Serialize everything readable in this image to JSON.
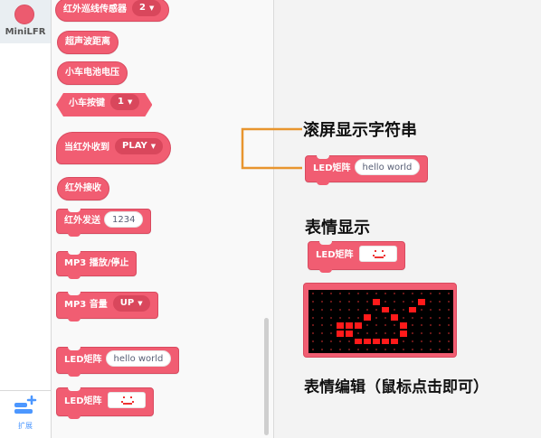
{
  "category_bar": {
    "device_label": "MiniLFR",
    "extension_label": "扩展"
  },
  "palette": {
    "blocks": [
      {
        "label": "红外巡线传感器",
        "dropdown": "2"
      },
      {
        "label": "超声波距离"
      },
      {
        "label": "小车电池电压"
      },
      {
        "label": "小车按键",
        "dropdown": "1"
      },
      {
        "label": "当红外收到",
        "dropdown": "PLAY"
      },
      {
        "label": "红外接收"
      },
      {
        "label": "红外发送",
        "field": "1234"
      },
      {
        "label": "MP3 播放/停止"
      },
      {
        "label": "MP3 音量",
        "dropdown": "UP"
      },
      {
        "label": "LED矩阵",
        "field": "hello world"
      },
      {
        "label": "LED矩阵"
      }
    ]
  },
  "workspace": {
    "annotations": {
      "scroll_text": "滚屏显示字符串",
      "expression": "表情显示",
      "expression_edit": "表情编辑（鼠标点击即可）"
    },
    "scroll_block": {
      "label": "LED矩阵",
      "field": "hello world"
    },
    "face_block": {
      "label": "LED矩阵"
    },
    "editor": {
      "rows": 8,
      "cols": 16,
      "on_cells": [
        [
          1,
          7
        ],
        [
          1,
          12
        ],
        [
          2,
          8
        ],
        [
          2,
          11
        ],
        [
          3,
          6
        ],
        [
          3,
          9
        ],
        [
          4,
          3
        ],
        [
          4,
          4
        ],
        [
          4,
          5
        ],
        [
          4,
          10
        ],
        [
          5,
          3
        ],
        [
          5,
          4
        ],
        [
          5,
          10
        ],
        [
          6,
          5
        ],
        [
          6,
          6
        ],
        [
          6,
          7
        ],
        [
          6,
          8
        ],
        [
          6,
          9
        ]
      ],
      "led_color": "#ff1a1a"
    }
  },
  "colors": {
    "block_fill": "#f15d72",
    "accent_blue": "#4c97ff",
    "bracket_orange": "#e8952e"
  }
}
